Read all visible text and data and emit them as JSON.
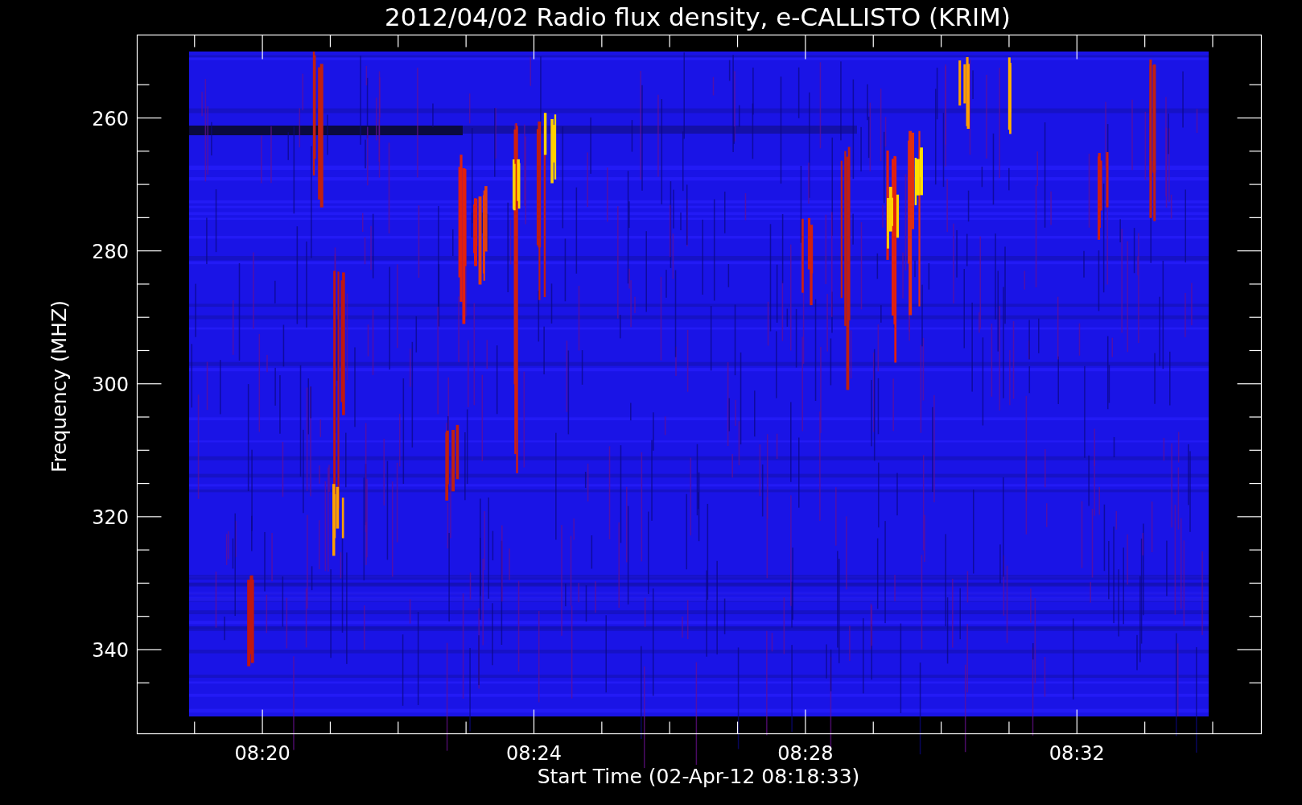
{
  "title": "2012/04/02  Radio flux density, e-CALLISTO (KRIM)",
  "y_axis": {
    "label": "Frequency (MHZ)",
    "ticks": [
      "260",
      "280",
      "300",
      "320",
      "340"
    ]
  },
  "x_axis": {
    "label": "Start Time (02-Apr-12 08:18:33)",
    "ticks": [
      "08:20",
      "08:24",
      "08:28",
      "08:32"
    ]
  }
}
